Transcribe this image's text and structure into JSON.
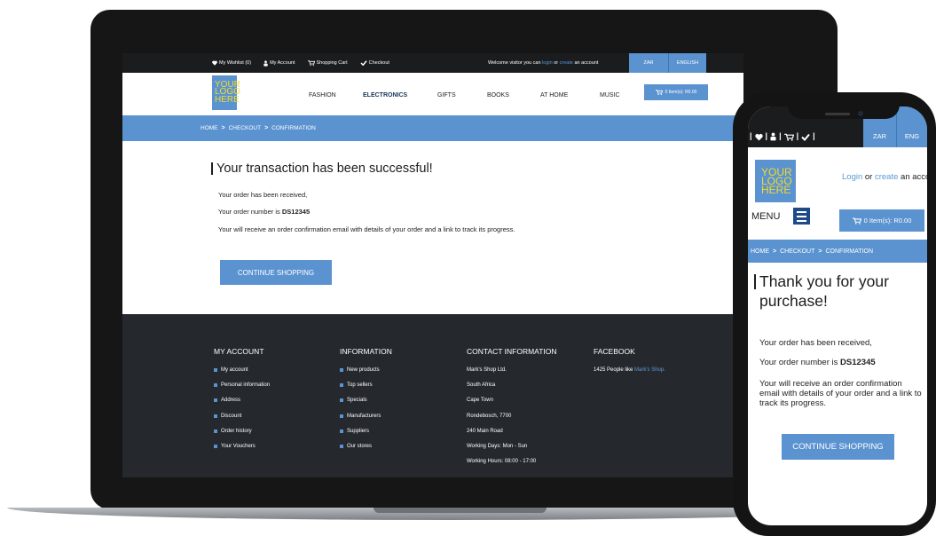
{
  "desktop": {
    "topbar": {
      "wishlist": "My Wishlist (0)",
      "account": "My Account",
      "cart": "Shopping Cart",
      "checkout": "Checkout",
      "welcome_prefix": "Welcome visitor you can",
      "login": "login",
      "or": "or",
      "create": "create",
      "welcome_suffix": "an account",
      "currency": "ZAR",
      "language": "ENGLISH"
    },
    "logo": [
      "YOUR",
      "LOGO",
      "HERE"
    ],
    "nav": [
      "FASHION",
      "ELECTRONICS",
      "GIFTS",
      "BOOKS",
      "AT HOME",
      "MUSIC"
    ],
    "active_nav": "ELECTRONICS",
    "cart_summary": "0 Item(s):  R0.00",
    "breadcrumb": [
      "HOME",
      "CHECKOUT",
      "CONFIRMATION"
    ],
    "heading": "Your transaction has been successful!",
    "received": "Your order has been received,",
    "order_prefix": "Your order number is",
    "order_number": "DS12345",
    "email_note": "Your will receive an order confirmation email with details of your order and a link to track its progress.",
    "button": "CONTINUE SHOPPING",
    "footer": {
      "my_account": {
        "title": "MY ACCOUNT",
        "items": [
          "My account",
          "Personal information",
          "Address",
          "Discount",
          "Order history",
          "Your Vouchers"
        ]
      },
      "information": {
        "title": "INFORMATION",
        "items": [
          "New products",
          "Top sellers",
          "Specials",
          "Manufacturers",
          "Suppliers",
          "Our stores"
        ]
      },
      "contact": {
        "title": "CONTACT INFORMATION",
        "lines": [
          "Mark's Shop Ltd.",
          "South Africa",
          "Cape Town",
          "Rondebosch, 7700",
          "240 Main Road",
          "Working Days: Mon - Sun",
          "Working Hours: 08:00 - 17:00"
        ]
      },
      "facebook": {
        "title": "FACEBOOK",
        "text": "1425 People like",
        "link": "Mark's Shop."
      }
    }
  },
  "mobile": {
    "currency": "ZAR",
    "language": "ENG",
    "logo": [
      "YOUR",
      "LOGO",
      "HERE"
    ],
    "login": "Login",
    "or": "or",
    "create": "create",
    "account_suffix": "an account",
    "menu": "MENU",
    "cart_summary": "0 Item(s):  R0.00",
    "breadcrumb": [
      "HOME",
      "CHECKOUT",
      "CONFIRMATION"
    ],
    "heading_line1": "Thank you for your",
    "heading_line2": "purchase!",
    "received": "Your order has been received,",
    "order_prefix": "Your order number is",
    "order_number": "DS12345",
    "email_note": "Your will receive an order confirmation email with details of your order and a link to track its progress.",
    "button": "CONTINUE SHOPPING"
  },
  "colors": {
    "accent": "#5b93d0",
    "topbar": "#1b1c1e",
    "footer": "#25292e",
    "logo_text": "#f2da2a"
  },
  "icons": [
    "heart-icon",
    "user-icon",
    "cart-icon",
    "check-icon",
    "hamburger-menu-icon"
  ]
}
